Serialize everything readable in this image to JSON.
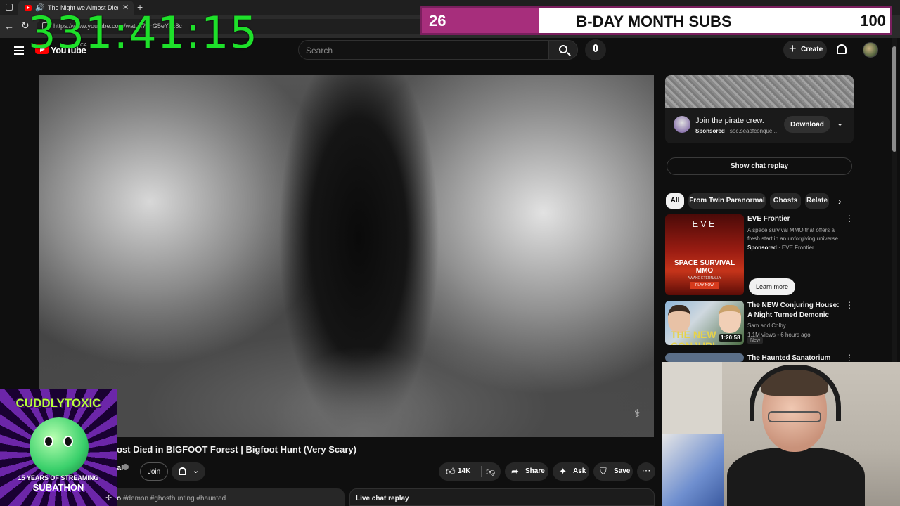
{
  "browser": {
    "tab_title": "The Night we Almost Died in BIGFOOT Forest | Bigfoot Hunt (Very Scary)",
    "url_text": "https://www.youtube.com/watch?v=G5eYdz8c",
    "new_tab_glyph": "+"
  },
  "overlays": {
    "timer": "331:41:15",
    "sub_goal": {
      "current": "26",
      "label": "B-DAY MONTH SUBS",
      "goal": "100",
      "progress_fraction": 0.26,
      "fill_color": "#a72e7c"
    },
    "logo": {
      "name": "CUDDLYTOXIC",
      "line1": "15 YEARS OF STREAMING",
      "line2": "SUBATHON"
    }
  },
  "youtube": {
    "logo_text": "YouTube",
    "country": "CA",
    "search_placeholder": "Search",
    "create_label": "Create",
    "video": {
      "title_visible": "ost Died in BIGFOOT Forest | Bigfoot Hunt (Very Scary)",
      "channel_fragment": "al",
      "join_label": "Join",
      "likes": "14K",
      "share_label": "Share",
      "ask_label": "Ask",
      "save_label": "Save",
      "description_lead": "o",
      "hashtags": "#demon #ghosthunting #haunted",
      "live_chat_label": "Live chat replay"
    },
    "sidebar": {
      "ad": {
        "title": "Join the pirate crew.",
        "sponsored": "Sponsored",
        "domain": "soc.seaofconque...",
        "download_label": "Download"
      },
      "show_chat_replay": "Show chat replay",
      "chips": [
        "All",
        "From Twin Paranormal",
        "Ghosts",
        "Relate"
      ],
      "videos": [
        {
          "title": "EVE Frontier",
          "description": "A space survival MMO that offers a fresh start in an unforgiving universe.",
          "sponsored": "Sponsored",
          "channel": "EVE Frontier",
          "thumb_logo": "EVE",
          "thumb_line": "SPACE SURVIVAL MMO",
          "thumb_sub": "AWAKE ETERNALLY",
          "thumb_play": "PLAY NOW",
          "cta": "Learn more"
        },
        {
          "title": "The NEW Conjuring House: A Night Turned Demonic",
          "channel": "Sam and Colby",
          "stats": "1.1M views • 6 hours ago",
          "badge": "New",
          "duration": "1:20:58",
          "thumb_word": "THE NEW CONJURI"
        },
        {
          "title": "The Haunted Sanatorium that"
        }
      ]
    }
  }
}
